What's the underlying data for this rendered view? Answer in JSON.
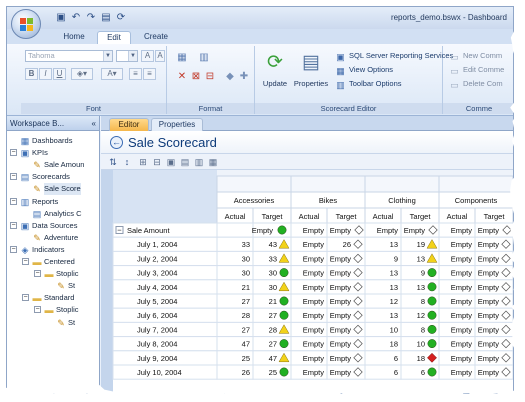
{
  "app": {
    "title": "reports_demo.bswx - Dashboard",
    "ribbon_tabs": [
      "Home",
      "Edit",
      "Create"
    ],
    "active_tab": "Edit"
  },
  "font_group": {
    "font_name": "Tahoma",
    "font_size": "",
    "label": "Font"
  },
  "format_group": {
    "label": "Format"
  },
  "scorecard_editor": {
    "update_label": "Update",
    "properties_label": "Properties",
    "ssrs_label": "SQL Server Reporting Services",
    "view_options_label": "View Options",
    "toolbar_options_label": "Toolbar Options",
    "label": "Scorecard Editor"
  },
  "comments_group": {
    "new_label": "New Comm",
    "edit_label": "Edit Comme",
    "delete_label": "Delete Com",
    "label": "Comme"
  },
  "workspace": {
    "title": "Workspace B...",
    "collapse": "«",
    "tree": [
      {
        "label": "Dashboards",
        "level": 0,
        "toggle": "",
        "icon": "dashboard-icon"
      },
      {
        "label": "KPIs",
        "level": 0,
        "toggle": "−",
        "icon": "kpi-folder-icon"
      },
      {
        "label": "Sale Amoun",
        "level": 1,
        "toggle": "",
        "icon": "kpi-icon"
      },
      {
        "label": "Scorecards",
        "level": 0,
        "toggle": "−",
        "icon": "scorecard-folder-icon"
      },
      {
        "label": "Sale Score",
        "level": 1,
        "toggle": "",
        "icon": "scorecard-icon",
        "selected": true
      },
      {
        "label": "Reports",
        "level": 0,
        "toggle": "−",
        "icon": "reports-folder-icon"
      },
      {
        "label": "Analytics C",
        "level": 1,
        "toggle": "",
        "icon": "report-icon"
      },
      {
        "label": "Data Sources",
        "level": 0,
        "toggle": "−",
        "icon": "datasource-folder-icon"
      },
      {
        "label": "Adventure",
        "level": 1,
        "toggle": "",
        "icon": "datasource-icon"
      },
      {
        "label": "Indicators",
        "level": 0,
        "toggle": "−",
        "icon": "indicators-folder-icon"
      },
      {
        "label": "Centered",
        "level": 1,
        "toggle": "−",
        "icon": "folder-icon"
      },
      {
        "label": "Stoplic",
        "level": 2,
        "toggle": "−",
        "icon": "folder-icon"
      },
      {
        "label": "St",
        "level": 3,
        "toggle": "",
        "icon": "indicator-icon"
      },
      {
        "label": "Standard",
        "level": 1,
        "toggle": "−",
        "icon": "folder-icon"
      },
      {
        "label": "Stoplic",
        "level": 2,
        "toggle": "−",
        "icon": "folder-icon"
      },
      {
        "label": "St",
        "level": 3,
        "toggle": "",
        "icon": "indicator-icon"
      }
    ]
  },
  "editor_tabs": [
    "Editor",
    "Properties"
  ],
  "active_editor_tab": "Editor",
  "scorecard": {
    "back": "←",
    "title": "Sale Scorecard",
    "categories": [
      "Accessories",
      "Bikes",
      "Clothing",
      "Components"
    ],
    "subcolumns": [
      "Actual",
      "Target"
    ],
    "kpi_label": "Sale Amount",
    "kpi_toggle": "−",
    "rows": [
      {
        "label": "July 1, 2004",
        "cells": [
          [
            "33",
            "43",
            "yellow"
          ],
          [
            "Empty",
            "26",
            "none"
          ],
          [
            "13",
            "19",
            "yellow"
          ],
          [
            "Empty",
            "Empty",
            "none"
          ]
        ]
      },
      {
        "label": "July 2, 2004",
        "cells": [
          [
            "30",
            "33",
            "yellow"
          ],
          [
            "Empty",
            "Empty",
            "none"
          ],
          [
            "9",
            "13",
            "yellow"
          ],
          [
            "Empty",
            "Empty",
            "none"
          ]
        ]
      },
      {
        "label": "July 3, 2004",
        "cells": [
          [
            "30",
            "30",
            "green"
          ],
          [
            "Empty",
            "Empty",
            "none"
          ],
          [
            "13",
            "9",
            "green"
          ],
          [
            "Empty",
            "Empty",
            "none"
          ]
        ]
      },
      {
        "label": "July 4, 2004",
        "cells": [
          [
            "21",
            "30",
            "yellow"
          ],
          [
            "Empty",
            "Empty",
            "none"
          ],
          [
            "13",
            "13",
            "green"
          ],
          [
            "Empty",
            "Empty",
            "none"
          ]
        ]
      },
      {
        "label": "July 5, 2004",
        "cells": [
          [
            "27",
            "21",
            "green"
          ],
          [
            "Empty",
            "Empty",
            "none"
          ],
          [
            "12",
            "8",
            "green"
          ],
          [
            "Empty",
            "Empty",
            "none"
          ]
        ]
      },
      {
        "label": "July 6, 2004",
        "cells": [
          [
            "28",
            "27",
            "green"
          ],
          [
            "Empty",
            "Empty",
            "none"
          ],
          [
            "13",
            "12",
            "green"
          ],
          [
            "Empty",
            "Empty",
            "none"
          ]
        ]
      },
      {
        "label": "July 7, 2004",
        "cells": [
          [
            "27",
            "28",
            "yellow"
          ],
          [
            "Empty",
            "Empty",
            "none"
          ],
          [
            "10",
            "8",
            "green"
          ],
          [
            "Empty",
            "Empty",
            "none"
          ]
        ]
      },
      {
        "label": "July 8, 2004",
        "cells": [
          [
            "47",
            "27",
            "green"
          ],
          [
            "Empty",
            "Empty",
            "none"
          ],
          [
            "18",
            "10",
            "green"
          ],
          [
            "Empty",
            "Empty",
            "none"
          ]
        ]
      },
      {
        "label": "July 9, 2004",
        "cells": [
          [
            "25",
            "47",
            "yellow"
          ],
          [
            "Empty",
            "Empty",
            "none"
          ],
          [
            "6",
            "18",
            "red"
          ],
          [
            "Empty",
            "Empty",
            "none"
          ]
        ]
      },
      {
        "label": "July 10, 2004",
        "cells": [
          [
            "26",
            "25",
            "green"
          ],
          [
            "Empty",
            "Empty",
            "none"
          ],
          [
            "6",
            "6",
            "green"
          ],
          [
            "Empty",
            "Empty",
            "none"
          ]
        ]
      }
    ],
    "first_row_target_accessories": "Empty",
    "first_row_actual_bikes": "Empty"
  },
  "colors": {
    "green": "#22b022",
    "yellow": "#f2d21a",
    "red": "#d42020",
    "empty_diamond": "#ffffff"
  }
}
